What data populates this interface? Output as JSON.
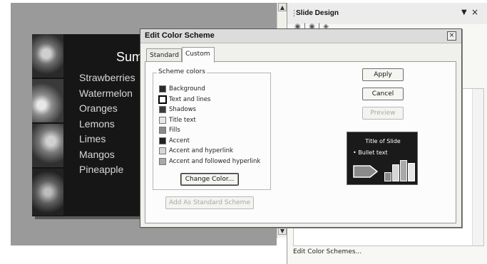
{
  "slide": {
    "title": "Summ",
    "items": [
      "Strawberries",
      "Watermelon",
      "Oranges",
      "Lemons",
      "Limes",
      "Mangos",
      "Pineapple"
    ]
  },
  "task_pane": {
    "title": "Slide Design",
    "dropdown_glyph": "▼",
    "close_glyph": "×",
    "toolbar_glyphs": "◉|◉|◈",
    "footer_link": "Edit Color Schemes..."
  },
  "dialog": {
    "title": "Edit Color Scheme",
    "close_glyph": "×",
    "tabs": [
      {
        "label": "Standard",
        "active": false
      },
      {
        "label": "Custom",
        "active": true
      }
    ],
    "scheme_colors": {
      "legend": "Scheme colors",
      "items": [
        {
          "label": "Background",
          "color": "#2a2a2a"
        },
        {
          "label": "Text and lines",
          "color": "#ffffff",
          "selected": true
        },
        {
          "label": "Shadows",
          "color": "#3a3a3a"
        },
        {
          "label": "Title text",
          "color": "#e6e6e6"
        },
        {
          "label": "Fills",
          "color": "#8a8a8a"
        },
        {
          "label": "Accent",
          "color": "#202020"
        },
        {
          "label": "Accent and hyperlink",
          "color": "#d6d6d6"
        },
        {
          "label": "Accent and followed hyperlink",
          "color": "#a9a9a9"
        }
      ]
    },
    "buttons": {
      "change_color": "Change Color...",
      "add_standard": "Add As Standard Scheme",
      "apply": "Apply",
      "cancel": "Cancel",
      "preview": "Preview"
    },
    "preview": {
      "title": "Title of Slide",
      "bullet": "•  Bullet text",
      "bar_levels": [
        0.4,
        0.75,
        0.95,
        0.8
      ]
    }
  }
}
